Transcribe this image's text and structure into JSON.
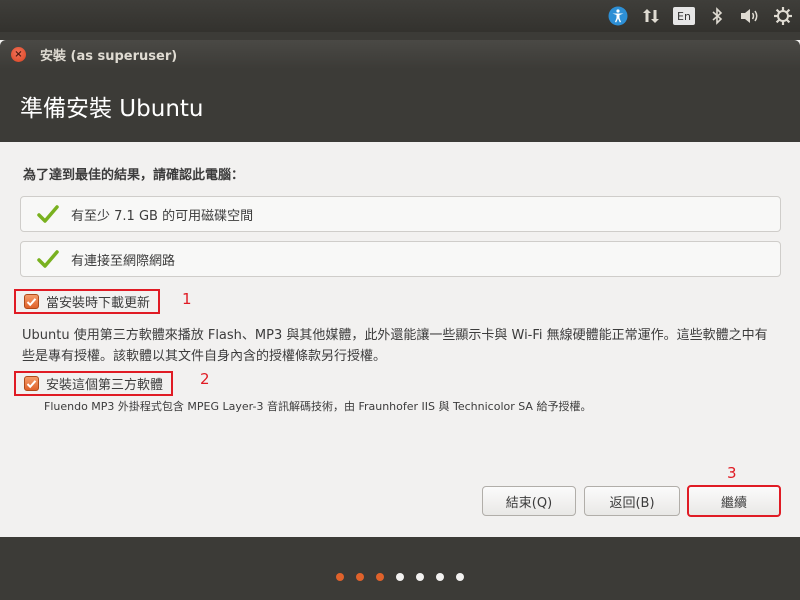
{
  "panel": {
    "icons": [
      "accessibility-icon",
      "network-arrows-icon",
      "keyboard-layout-icon",
      "bluetooth-icon",
      "volume-icon",
      "gear-icon"
    ],
    "language": "En"
  },
  "window": {
    "title": "安裝 (as superuser)",
    "page_title": "準備安裝 Ubuntu"
  },
  "content": {
    "subtitle": "為了達到最佳的結果，請確認此電腦：",
    "requirements": [
      "有至少 7.1 GB 的可用磁碟空間",
      "有連接至網際網路"
    ],
    "download_updates_label": "當安裝時下載更新",
    "description": "Ubuntu 使用第三方軟體來播放 Flash、MP3 與其他媒體，此外還能讓一些顯示卡與 Wi-Fi 無線硬體能正常運作。這些軟體之中有些是專有授權。該軟體以其文件自身內含的授權條款另行授權。",
    "third_party_label": "安裝這個第三方軟體",
    "third_party_note": "Fluendo MP3 外掛程式包含 MPEG Layer-3 音訊解碼技術，由 Fraunhofer IIS 與 Technicolor SA 給予授權。"
  },
  "annotations": [
    "1",
    "2",
    "3"
  ],
  "buttons": {
    "quit": "結束(Q)",
    "back": "返回(B)",
    "continue": "繼續"
  },
  "progress": {
    "total_steps": 7,
    "completed_steps": 3,
    "active_color": "#e0622b",
    "inactive_color": "#f2f1f0"
  },
  "colors": {
    "accent": "#e0622b",
    "annotation_red": "#e01b24",
    "panel_bg": "#3c3b37"
  }
}
